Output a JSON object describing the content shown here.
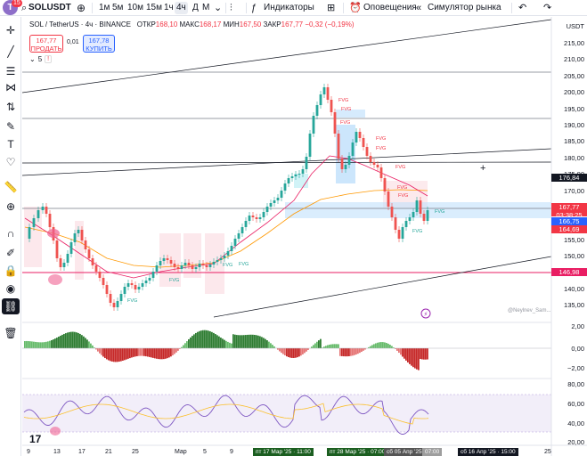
{
  "topbar": {
    "avatar_letter": "T",
    "avatar_badge": "15",
    "symbol": "SOLUSDT",
    "timeframes": [
      "1м",
      "5м",
      "10м",
      "15м",
      "1ч",
      "4ч",
      "Д",
      "М"
    ],
    "active_timeframe": "4ч",
    "indicators_label": "Индикаторы",
    "alerts_label": "Оповещения",
    "replay_label": "Симулятор рынка"
  },
  "legend": {
    "title": "SOL / TetherUS · 4ч · BINANCE",
    "open_label": "ОТКР",
    "open": "168,10",
    "high_label": "МАКС",
    "high": "168,17",
    "low_label": "МИН",
    "low": "167,50",
    "close_label": "ЗАКР",
    "close": "167,77",
    "change": "−0,32 (−0,19%)"
  },
  "trade": {
    "sell_price": "167,77",
    "sell_label": "ПРОДАТЬ",
    "spread": "0,01",
    "buy_price": "167,78",
    "buy_label": "КУПИТЬ"
  },
  "indicators_count": "5",
  "currency": "USDT",
  "price_axis": [
    "215,00",
    "210,00",
    "205,00",
    "200,00",
    "195,00",
    "190,00",
    "185,00",
    "180,00",
    "175,00",
    "170,00",
    "165,00",
    "160,00",
    "155,00",
    "150,00",
    "145,00",
    "140,00",
    "135,00"
  ],
  "price_tags": {
    "level1": "176,84",
    "last": "167,77",
    "countdown": "03:38:25",
    "level2": "166,75",
    "low": "164,69",
    "level3": "146,98"
  },
  "osc_axis": [
    "2,00",
    "0,00",
    "−2,00"
  ],
  "rsi_axis": [
    "80,00",
    "60,00",
    "40,00",
    "20,00"
  ],
  "fvg_label": "FVG",
  "watermark": "@Neylnev_Sam...",
  "x_axis": [
    "9",
    "13",
    "17",
    "21",
    "25",
    "Мар",
    "5",
    "9",
    "25"
  ],
  "time_boxes": [
    "пт 17 Мар '25 · 11:00",
    "пт 28 Мар '25 · 07:00",
    "сб 05 Апр '25",
    "07:00",
    "сб 16 Апр '25 · 15:00"
  ],
  "colors": {
    "up": "#26a69a",
    "down": "#ef5350",
    "ma_orange": "#ff9800",
    "ma_red": "#e91e63"
  }
}
